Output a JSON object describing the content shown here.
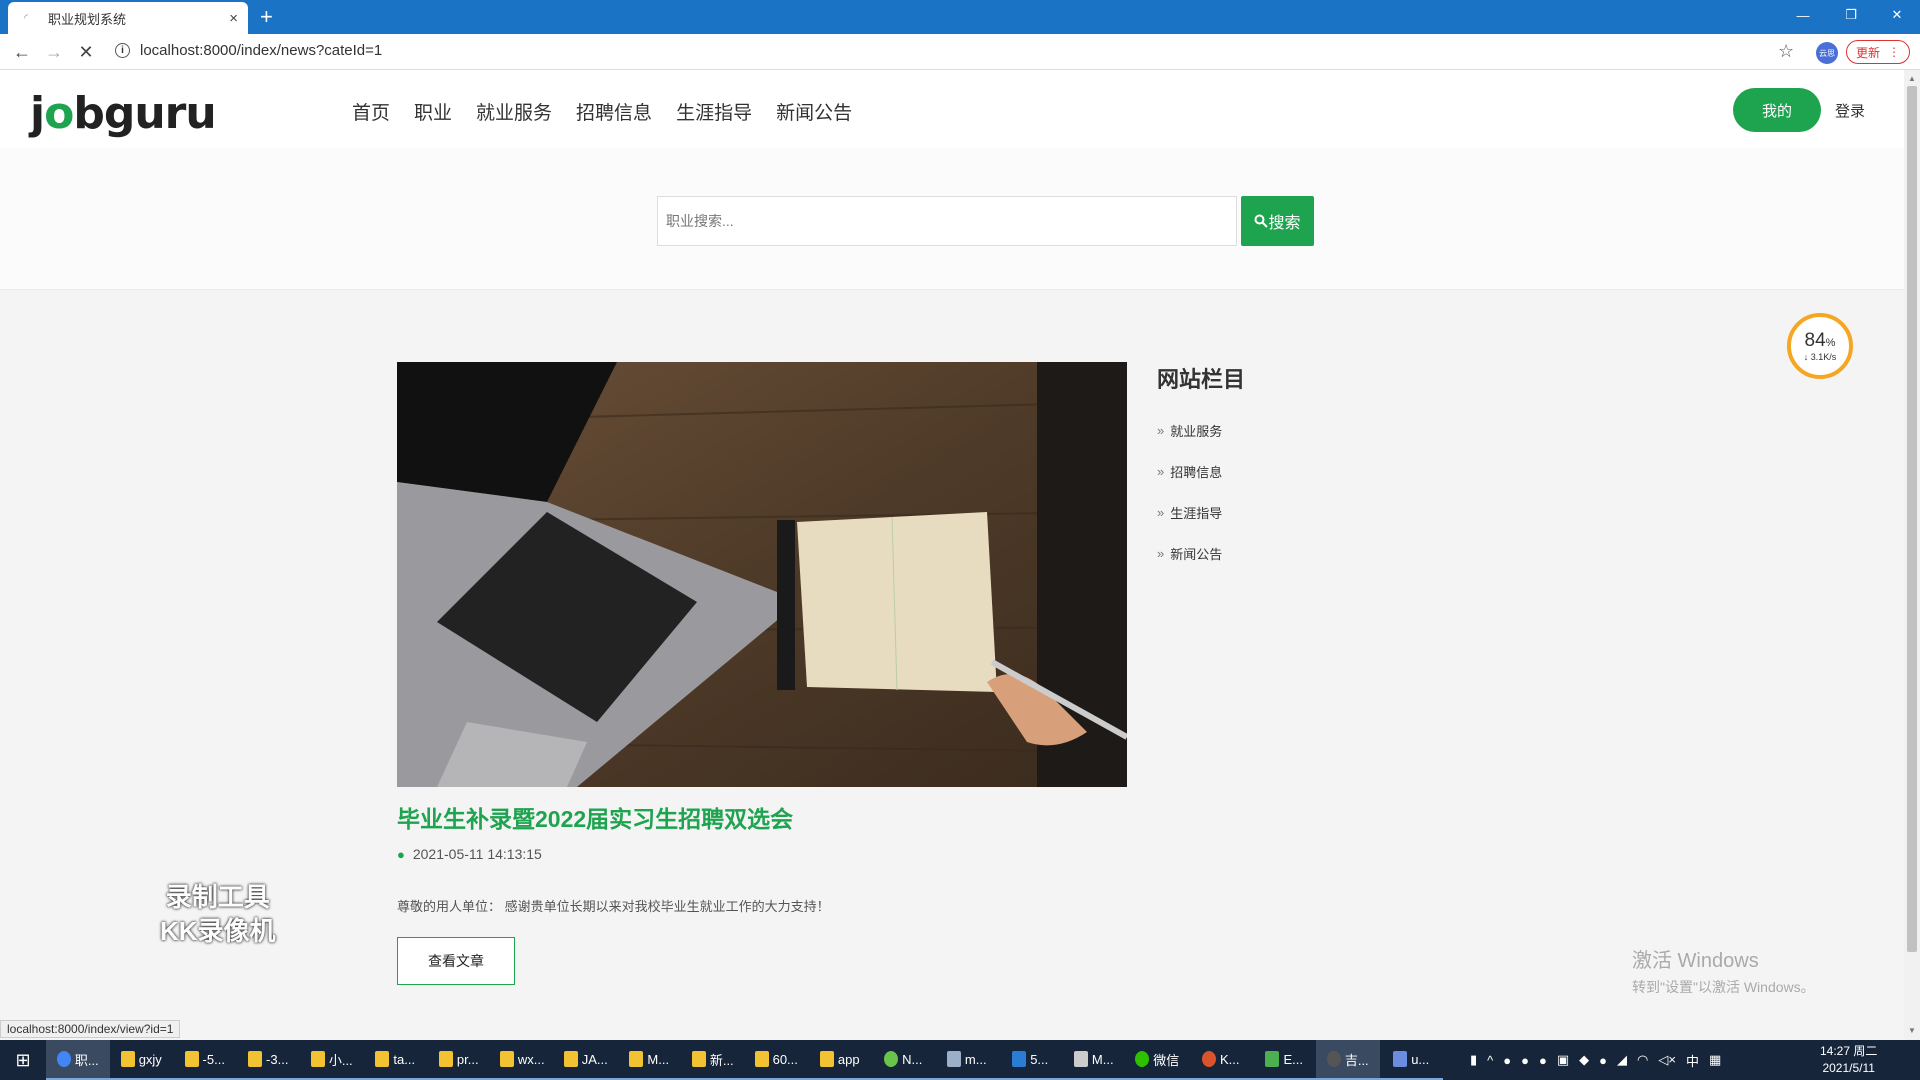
{
  "browser": {
    "tab_title": "职业规划系统",
    "tab_close": "×",
    "new_tab": "+",
    "url": "localhost:8000/index/news?cateId=1",
    "update_label": "更新",
    "profile_label": "云思",
    "status_url": "localhost:8000/index/view?id=1"
  },
  "site": {
    "logo_pre": "j",
    "logo_o": "o",
    "logo_post": "bguru",
    "nav": [
      "首页",
      "职业",
      "就业服务",
      "招聘信息",
      "生涯指导",
      "新闻公告"
    ],
    "my_button": "我的",
    "login": "登录"
  },
  "search": {
    "placeholder": "职业搜索...",
    "button_label": "搜索"
  },
  "article": {
    "title": "毕业生补录暨2022届实习生招聘双选会",
    "date": "2021-05-11 14:13:15",
    "excerpt": "尊敬的用人单位：  感谢贵单位长期以来对我校毕业生就业工作的大力支持！",
    "read_more": "查看文章"
  },
  "sidebar": {
    "title": "网站栏目",
    "items": [
      "就业服务",
      "招聘信息",
      "生涯指导",
      "新闻公告"
    ]
  },
  "speed_widget": {
    "percent": "84",
    "unit": "%",
    "rate": "↓ 3.1K/s"
  },
  "watermark": {
    "line1": "录制工具",
    "line2": "KK录像机"
  },
  "activation": {
    "line1": "激活 Windows",
    "line2": "转到\"设置\"以激活 Windows。"
  },
  "taskbar": {
    "items": [
      "职...",
      "gxjy",
      "-5...",
      "-3...",
      "小...",
      "ta...",
      "pr...",
      "wx...",
      "JA...",
      "M...",
      "新...",
      "60...",
      "app",
      "N...",
      "m...",
      "5...",
      "M...",
      "微信",
      "K...",
      "E...",
      "吉...",
      "u..."
    ],
    "ime": "中",
    "time": "14:27 周二",
    "date": "2021/5/11"
  }
}
